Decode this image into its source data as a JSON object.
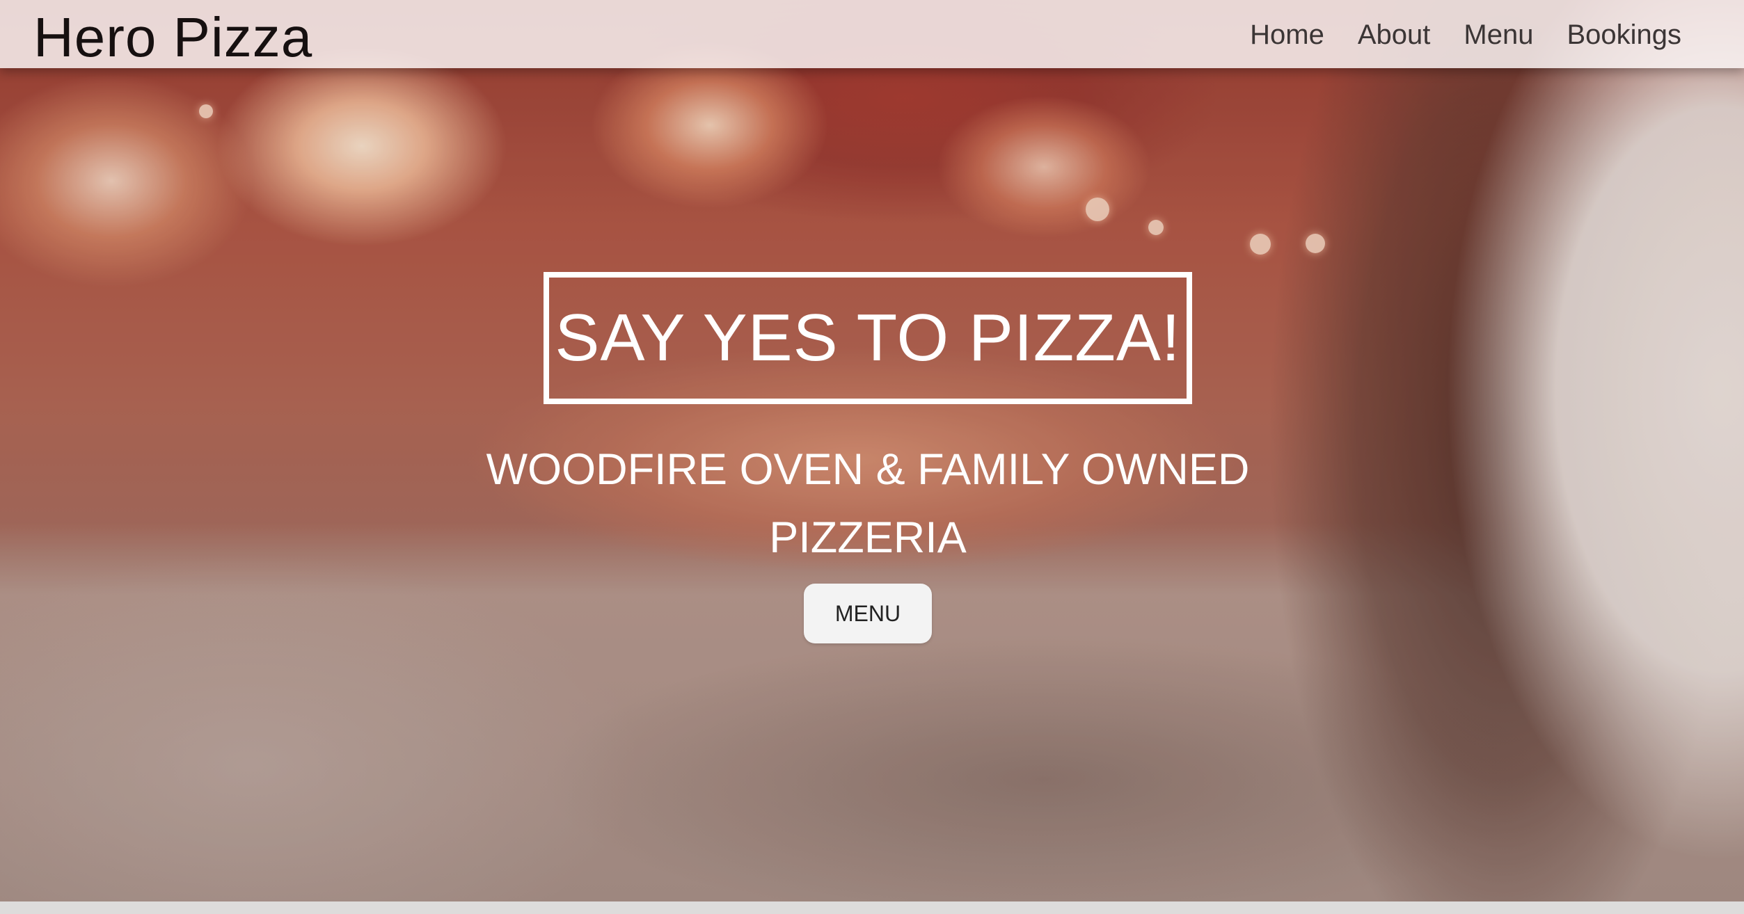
{
  "navbar": {
    "brand": "Hero Pizza",
    "links": [
      "Home",
      "About",
      "Menu",
      "Bookings"
    ]
  },
  "hero": {
    "headline": "SAY YES TO PIZZA!",
    "subheadline": "WOODFIRE OVEN & FAMILY OWNED PIZZERIA",
    "cta_label": "MENU"
  },
  "colors": {
    "headline_text": "#ffffff",
    "button_bg": "#f3f3f3",
    "nav_text": "#3b3535",
    "brand_text": "#161010"
  }
}
